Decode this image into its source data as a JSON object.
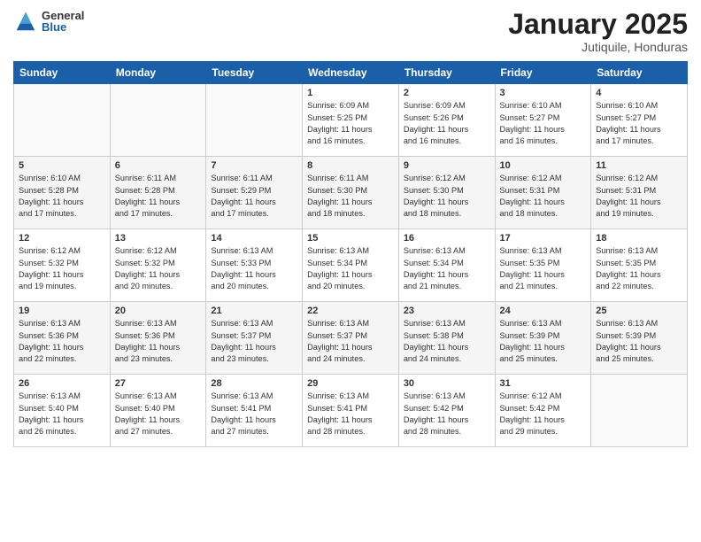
{
  "logo": {
    "general": "General",
    "blue": "Blue"
  },
  "title": "January 2025",
  "location": "Jutiquile, Honduras",
  "days_header": [
    "Sunday",
    "Monday",
    "Tuesday",
    "Wednesday",
    "Thursday",
    "Friday",
    "Saturday"
  ],
  "weeks": [
    [
      {
        "day": "",
        "info": ""
      },
      {
        "day": "",
        "info": ""
      },
      {
        "day": "",
        "info": ""
      },
      {
        "day": "1",
        "info": "Sunrise: 6:09 AM\nSunset: 5:25 PM\nDaylight: 11 hours\nand 16 minutes."
      },
      {
        "day": "2",
        "info": "Sunrise: 6:09 AM\nSunset: 5:26 PM\nDaylight: 11 hours\nand 16 minutes."
      },
      {
        "day": "3",
        "info": "Sunrise: 6:10 AM\nSunset: 5:27 PM\nDaylight: 11 hours\nand 16 minutes."
      },
      {
        "day": "4",
        "info": "Sunrise: 6:10 AM\nSunset: 5:27 PM\nDaylight: 11 hours\nand 17 minutes."
      }
    ],
    [
      {
        "day": "5",
        "info": "Sunrise: 6:10 AM\nSunset: 5:28 PM\nDaylight: 11 hours\nand 17 minutes."
      },
      {
        "day": "6",
        "info": "Sunrise: 6:11 AM\nSunset: 5:28 PM\nDaylight: 11 hours\nand 17 minutes."
      },
      {
        "day": "7",
        "info": "Sunrise: 6:11 AM\nSunset: 5:29 PM\nDaylight: 11 hours\nand 17 minutes."
      },
      {
        "day": "8",
        "info": "Sunrise: 6:11 AM\nSunset: 5:30 PM\nDaylight: 11 hours\nand 18 minutes."
      },
      {
        "day": "9",
        "info": "Sunrise: 6:12 AM\nSunset: 5:30 PM\nDaylight: 11 hours\nand 18 minutes."
      },
      {
        "day": "10",
        "info": "Sunrise: 6:12 AM\nSunset: 5:31 PM\nDaylight: 11 hours\nand 18 minutes."
      },
      {
        "day": "11",
        "info": "Sunrise: 6:12 AM\nSunset: 5:31 PM\nDaylight: 11 hours\nand 19 minutes."
      }
    ],
    [
      {
        "day": "12",
        "info": "Sunrise: 6:12 AM\nSunset: 5:32 PM\nDaylight: 11 hours\nand 19 minutes."
      },
      {
        "day": "13",
        "info": "Sunrise: 6:12 AM\nSunset: 5:32 PM\nDaylight: 11 hours\nand 20 minutes."
      },
      {
        "day": "14",
        "info": "Sunrise: 6:13 AM\nSunset: 5:33 PM\nDaylight: 11 hours\nand 20 minutes."
      },
      {
        "day": "15",
        "info": "Sunrise: 6:13 AM\nSunset: 5:34 PM\nDaylight: 11 hours\nand 20 minutes."
      },
      {
        "day": "16",
        "info": "Sunrise: 6:13 AM\nSunset: 5:34 PM\nDaylight: 11 hours\nand 21 minutes."
      },
      {
        "day": "17",
        "info": "Sunrise: 6:13 AM\nSunset: 5:35 PM\nDaylight: 11 hours\nand 21 minutes."
      },
      {
        "day": "18",
        "info": "Sunrise: 6:13 AM\nSunset: 5:35 PM\nDaylight: 11 hours\nand 22 minutes."
      }
    ],
    [
      {
        "day": "19",
        "info": "Sunrise: 6:13 AM\nSunset: 5:36 PM\nDaylight: 11 hours\nand 22 minutes."
      },
      {
        "day": "20",
        "info": "Sunrise: 6:13 AM\nSunset: 5:36 PM\nDaylight: 11 hours\nand 23 minutes."
      },
      {
        "day": "21",
        "info": "Sunrise: 6:13 AM\nSunset: 5:37 PM\nDaylight: 11 hours\nand 23 minutes."
      },
      {
        "day": "22",
        "info": "Sunrise: 6:13 AM\nSunset: 5:37 PM\nDaylight: 11 hours\nand 24 minutes."
      },
      {
        "day": "23",
        "info": "Sunrise: 6:13 AM\nSunset: 5:38 PM\nDaylight: 11 hours\nand 24 minutes."
      },
      {
        "day": "24",
        "info": "Sunrise: 6:13 AM\nSunset: 5:39 PM\nDaylight: 11 hours\nand 25 minutes."
      },
      {
        "day": "25",
        "info": "Sunrise: 6:13 AM\nSunset: 5:39 PM\nDaylight: 11 hours\nand 25 minutes."
      }
    ],
    [
      {
        "day": "26",
        "info": "Sunrise: 6:13 AM\nSunset: 5:40 PM\nDaylight: 11 hours\nand 26 minutes."
      },
      {
        "day": "27",
        "info": "Sunrise: 6:13 AM\nSunset: 5:40 PM\nDaylight: 11 hours\nand 27 minutes."
      },
      {
        "day": "28",
        "info": "Sunrise: 6:13 AM\nSunset: 5:41 PM\nDaylight: 11 hours\nand 27 minutes."
      },
      {
        "day": "29",
        "info": "Sunrise: 6:13 AM\nSunset: 5:41 PM\nDaylight: 11 hours\nand 28 minutes."
      },
      {
        "day": "30",
        "info": "Sunrise: 6:13 AM\nSunset: 5:42 PM\nDaylight: 11 hours\nand 28 minutes."
      },
      {
        "day": "31",
        "info": "Sunrise: 6:12 AM\nSunset: 5:42 PM\nDaylight: 11 hours\nand 29 minutes."
      },
      {
        "day": "",
        "info": ""
      }
    ]
  ]
}
